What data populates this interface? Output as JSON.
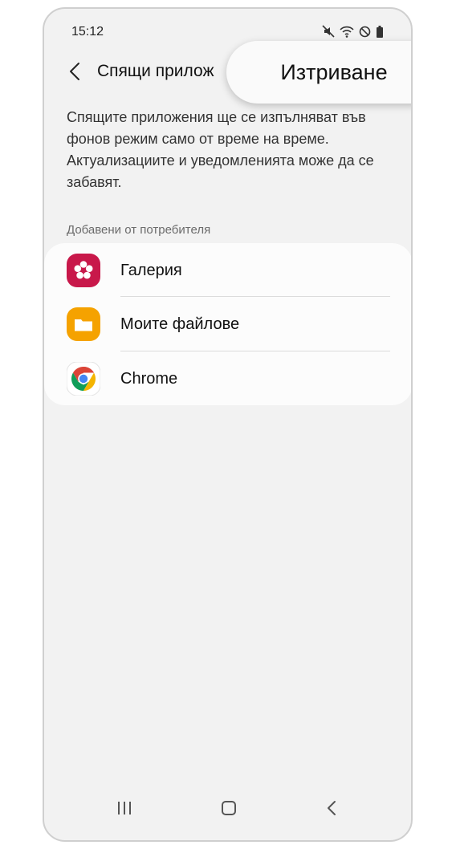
{
  "status_bar": {
    "time": "15:12",
    "icons": [
      "mute-icon",
      "wifi-icon",
      "do-not-disturb-icon",
      "battery-icon"
    ]
  },
  "app_bar": {
    "title": "Спящи прилож",
    "back_icon": "chevron-left-icon"
  },
  "popup": {
    "label": "Изтриване"
  },
  "description": "Спящите приложения ще се изпълняват във фонов режим само от време на време. Актуализациите и уведомленията може да се забавят.",
  "section_header": "Добавени от потребителя",
  "apps": [
    {
      "label": "Галерия",
      "icon": "gallery-icon",
      "color": "#c8184a"
    },
    {
      "label": "Моите файлове",
      "icon": "my-files-icon",
      "color": "#f5a200"
    },
    {
      "label": "Chrome",
      "icon": "chrome-icon",
      "color": "#4285f4"
    }
  ],
  "nav_bar": {
    "icons": [
      "recent-apps-icon",
      "home-icon",
      "back-icon"
    ]
  }
}
